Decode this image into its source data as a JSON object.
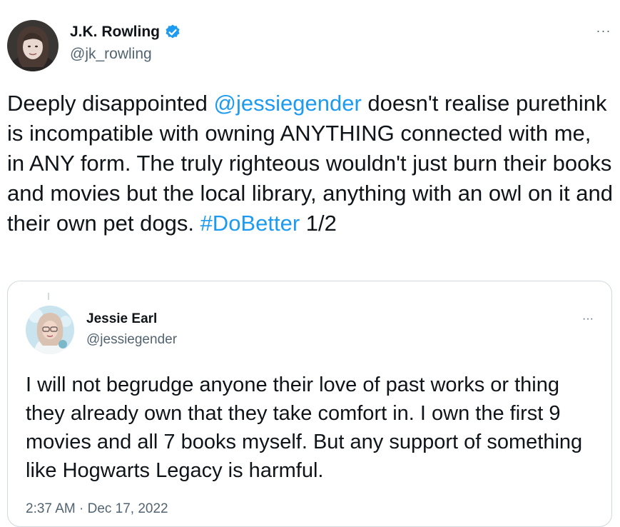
{
  "tweet": {
    "author": {
      "name": "J.K. Rowling",
      "handle": "@jk_rowling",
      "verified": true
    },
    "more_label": "···",
    "text": {
      "part1": "Deeply disappointed ",
      "mention": "@jessiegender",
      "part2": " doesn't realise purethink is incompatible with owning ANYTHING connected with me, in ANY form. The truly righteous wouldn't just burn their books and movies but the local library, anything with an owl on it and their own pet dogs. ",
      "hashtag": "#DoBetter",
      "part3": " 1/2"
    }
  },
  "quoted_tweet": {
    "author": {
      "name": "Jessie Earl",
      "handle": "@jessiegender"
    },
    "more_label": "···",
    "text": "I will not begrudge anyone their love of past works or thing they already own that they take comfort in. I own the first 9 movies and all 7 books myself. But any support of something like Hogwarts Legacy is harmful.",
    "timestamp": "2:37 AM · Dec 17, 2022"
  },
  "colors": {
    "text": "#0f1419",
    "secondary": "#536471",
    "link": "#1d9bf0",
    "verified": "#1d9bf0",
    "border": "#cfd9de"
  },
  "icons": {
    "verified": "verified-badge-icon",
    "more": "more-options-icon"
  }
}
